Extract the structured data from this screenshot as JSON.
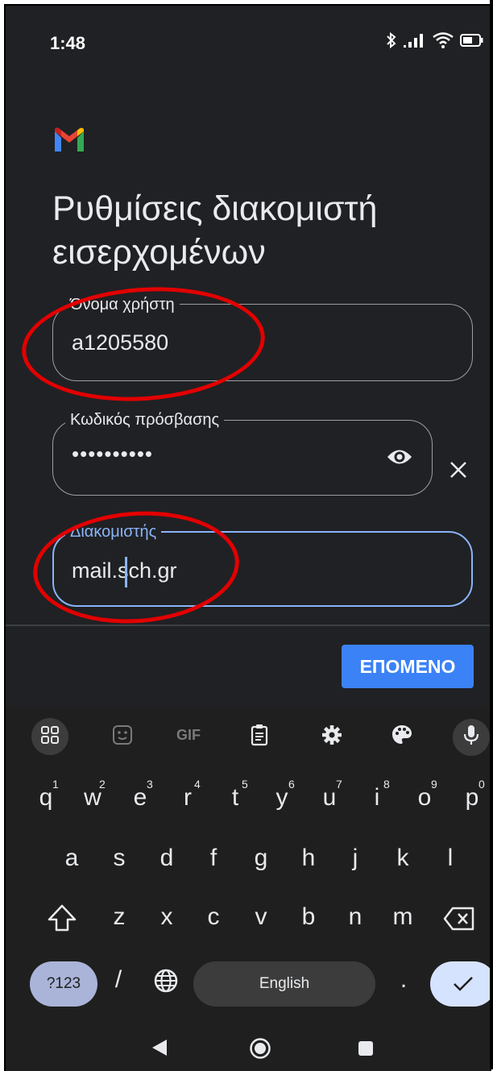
{
  "status_bar": {
    "time": "1:48",
    "battery": "52",
    "battery_unit": "%"
  },
  "app": {
    "logo_icon": "gmail-m-icon"
  },
  "page": {
    "title": "Ρυθμίσεις διακομιστή εισερχομένων"
  },
  "form": {
    "username": {
      "label": "Όνομα χρήστη",
      "value": "a1205580"
    },
    "password": {
      "label": "Κωδικός πρόσβασης",
      "value": "••••••••••"
    },
    "server": {
      "label": "Διακομιστής",
      "value": "mail.sch.gr"
    }
  },
  "actions": {
    "next_label": "ΕΠΟΜΕΝΟ"
  },
  "keyboard": {
    "toolbar": {
      "gif_label": "GIF"
    },
    "row1": [
      {
        "key": "q",
        "num": "1"
      },
      {
        "key": "w",
        "num": "2"
      },
      {
        "key": "e",
        "num": "3"
      },
      {
        "key": "r",
        "num": "4"
      },
      {
        "key": "t",
        "num": "5"
      },
      {
        "key": "y",
        "num": "6"
      },
      {
        "key": "u",
        "num": "7"
      },
      {
        "key": "i",
        "num": "8"
      },
      {
        "key": "o",
        "num": "9"
      },
      {
        "key": "p",
        "num": "0"
      }
    ],
    "row2": [
      "a",
      "s",
      "d",
      "f",
      "g",
      "h",
      "j",
      "k",
      "l"
    ],
    "row3": [
      "z",
      "x",
      "c",
      "v",
      "b",
      "n",
      "m"
    ],
    "symbols_label": "?123",
    "slash_label": "/",
    "space_label": "English",
    "period_label": "."
  },
  "colors": {
    "background": "#202124",
    "accent": "#8ab4f8",
    "button": "#3b82f6",
    "annotation": "#e20000"
  }
}
